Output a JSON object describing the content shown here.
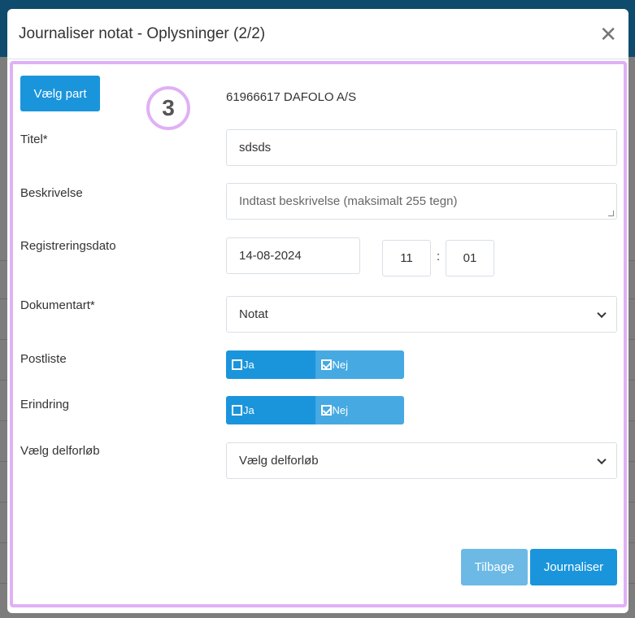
{
  "modal": {
    "title": "Journaliser notat - Oplysninger (2/2)",
    "close_icon": "close-icon",
    "step_badge": "3",
    "choose_party_label": "Vælg part",
    "party": "61966617  DAFOLO A/S",
    "fields": {
      "title_label": "Titel*",
      "title_value": "sdsds",
      "description_label": "Beskrivelse",
      "description_placeholder": "Indtast beskrivelse (maksimalt 255 tegn)",
      "date_label": "Registreringsdato",
      "date_value": "14-08-2024",
      "hour": "11",
      "time_sep": ":",
      "minute": "01",
      "doctype_label": "Dokumentart*",
      "doctype_value": "Notat",
      "postliste_label": "Postliste",
      "erindring_label": "Erindring",
      "yes": "Ja",
      "no": "Nej",
      "postliste_selected": "Nej",
      "erindring_selected": "Nej",
      "subflow_label": "Vælg delforløb",
      "subflow_value": "Vælg delforløb"
    },
    "back_label": "Tilbage",
    "submit_label": "Journaliser"
  },
  "colors": {
    "primary": "#1a95dc",
    "highlight": "#e0b0f5",
    "header_bg": "#0e4b6c"
  }
}
